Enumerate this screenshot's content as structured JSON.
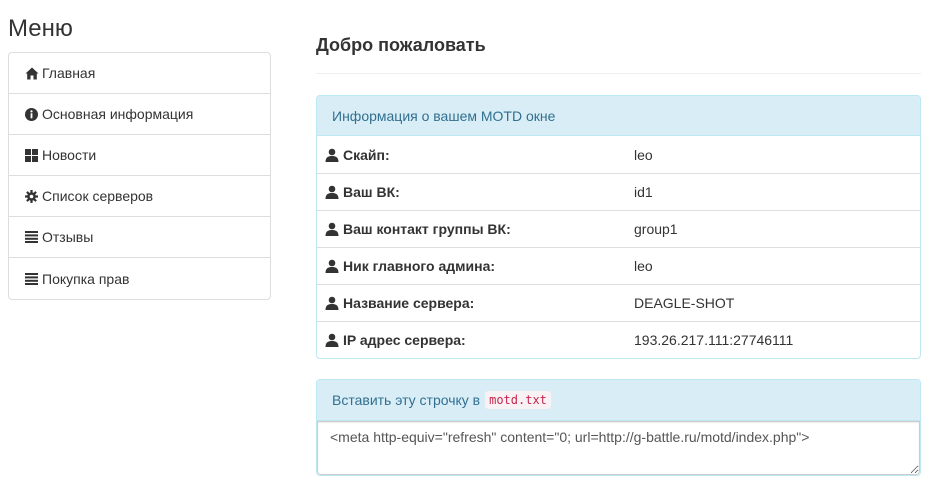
{
  "sidebar": {
    "title": "Меню",
    "items": [
      {
        "label": "Главная",
        "icon": "home-icon"
      },
      {
        "label": "Основная информация",
        "icon": "info-icon"
      },
      {
        "label": "Новости",
        "icon": "grid-icon"
      },
      {
        "label": "Список серверов",
        "icon": "gear-icon"
      },
      {
        "label": "Отзывы",
        "icon": "list-icon"
      },
      {
        "label": "Покупка прав",
        "icon": "list-icon"
      }
    ]
  },
  "main": {
    "welcome": "Добро пожаловать",
    "info_panel": {
      "heading": "Информация о вашем MOTD окне",
      "rows": [
        {
          "label": "Скайп:",
          "value": "leo"
        },
        {
          "label": "Ваш ВК:",
          "value": "id1"
        },
        {
          "label": "Ваш контакт группы ВК:",
          "value": "group1"
        },
        {
          "label": "Ник главного админа:",
          "value": "leo"
        },
        {
          "label": "Название сервера:",
          "value": "DEAGLE-SHOT"
        },
        {
          "label": "IP адрес сервера:",
          "value": "193.26.217.111:27746111"
        }
      ]
    },
    "code_panel": {
      "heading": "Вставить эту строчку в",
      "filename": "motd.txt",
      "code": "<meta http-equiv=\"refresh\" content=\"0; url=http://g-battle.ru/motd/index.php\">"
    }
  },
  "colors": {
    "panel_heading_bg": "#d9edf7",
    "panel_heading_text": "#31708f",
    "panel_border": "#bce8f1",
    "code_text": "#c7254e"
  }
}
